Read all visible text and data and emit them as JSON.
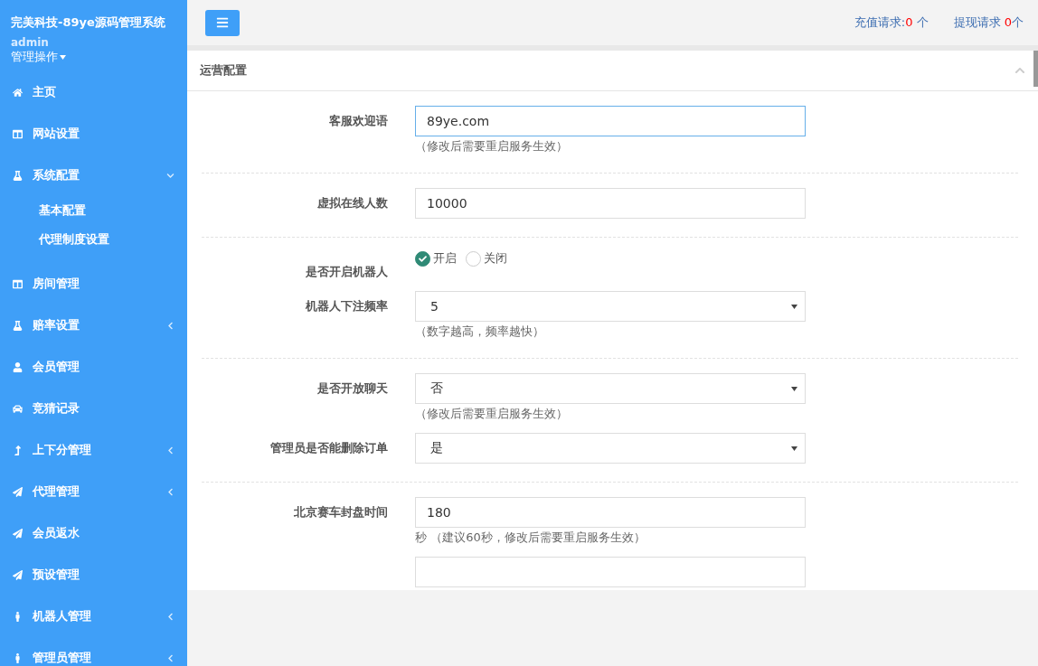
{
  "sidebar": {
    "title": "完美科技-89ye源码管理系统",
    "user": "admin",
    "user_menu": "管理操作",
    "items": [
      {
        "label": "主页",
        "kind": "plain"
      },
      {
        "label": "网站设置",
        "kind": "plain"
      },
      {
        "label": "系统配置",
        "kind": "group",
        "expanded": true,
        "children": [
          {
            "label": "基本配置"
          },
          {
            "label": "代理制度设置"
          }
        ]
      },
      {
        "label": "房间管理",
        "kind": "plain"
      },
      {
        "label": "赔率设置",
        "kind": "group",
        "expanded": false
      },
      {
        "label": "会员管理",
        "kind": "plain"
      },
      {
        "label": "竞猜记录",
        "kind": "plain"
      },
      {
        "label": "上下分管理",
        "kind": "group",
        "expanded": false
      },
      {
        "label": "代理管理",
        "kind": "group",
        "expanded": false
      },
      {
        "label": "会员返水",
        "kind": "plain"
      },
      {
        "label": "预设管理",
        "kind": "plain"
      },
      {
        "label": "机器人管理",
        "kind": "group",
        "expanded": false
      },
      {
        "label": "管理员管理",
        "kind": "group",
        "expanded": false
      }
    ]
  },
  "topbar": {
    "requests": [
      {
        "label": "充值请求:",
        "count": "0",
        "unit": " 个"
      },
      {
        "label": "提现请求 ",
        "count": "0",
        "unit": "个"
      }
    ]
  },
  "panel": {
    "title": "运营配置",
    "sections": [
      {
        "fields": [
          {
            "kind": "input",
            "label": "客服欢迎语",
            "value": "89ye.com",
            "focused": true,
            "hint": "（修改后需要重启服务生效）"
          }
        ]
      },
      {
        "fields": [
          {
            "kind": "input",
            "label": "虚拟在线人数",
            "value": "10000",
            "focused": false
          }
        ]
      },
      {
        "fields": [
          {
            "kind": "radio",
            "label": "是否开启机器人",
            "options": [
              {
                "label": "开启",
                "selected": true
              },
              {
                "label": "关闭",
                "selected": false
              }
            ]
          },
          {
            "kind": "select",
            "label": "机器人下注频率",
            "value": "5",
            "hint": "（数字越高，频率越快）"
          }
        ]
      },
      {
        "fields": [
          {
            "kind": "select",
            "label": "是否开放聊天",
            "value": "否",
            "hint": "（修改后需要重启服务生效）"
          },
          {
            "kind": "select",
            "label": "管理员是否能删除订单",
            "value": "是"
          }
        ]
      },
      {
        "fields": [
          {
            "kind": "input",
            "label": "北京赛车封盘时间",
            "value": "180",
            "focused": false,
            "hint": "秒 （建议60秒，修改后需要重启服务生效）"
          },
          {
            "kind": "input",
            "focused": false
          }
        ]
      }
    ]
  }
}
